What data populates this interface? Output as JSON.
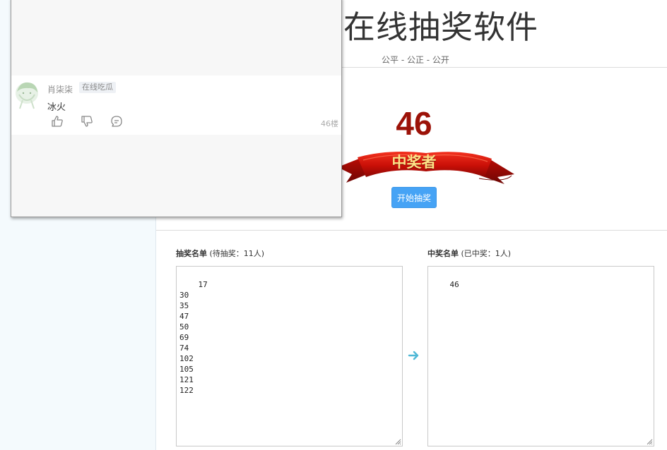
{
  "header": {
    "title": "在线抽奖软件",
    "subtitle": "公平 - 公正 - 公开"
  },
  "winner": {
    "number": "46",
    "ribbon_label": "中奖者",
    "start_button_label": "开始抽奖"
  },
  "pool": {
    "heading": "抽奖名单",
    "status": "(待抽奖：11人)",
    "entries": "17\n30\n35\n47\n50\n69\n74\n102\n105\n121\n122"
  },
  "winners_list": {
    "heading": "中奖名单",
    "status": "(已中奖：1人)",
    "entries": "46"
  },
  "popup": {
    "comment": {
      "user_name": "肖柒柒",
      "user_tag": "在线吃瓜",
      "text": "冰火",
      "floor": "46楼"
    }
  },
  "colors": {
    "accent": "#46a3f5",
    "winner_red": "#9c1208",
    "ribbon_red": "#d7140a",
    "ribbon_text": "#fde488",
    "arrow": "#4fb8d6"
  }
}
